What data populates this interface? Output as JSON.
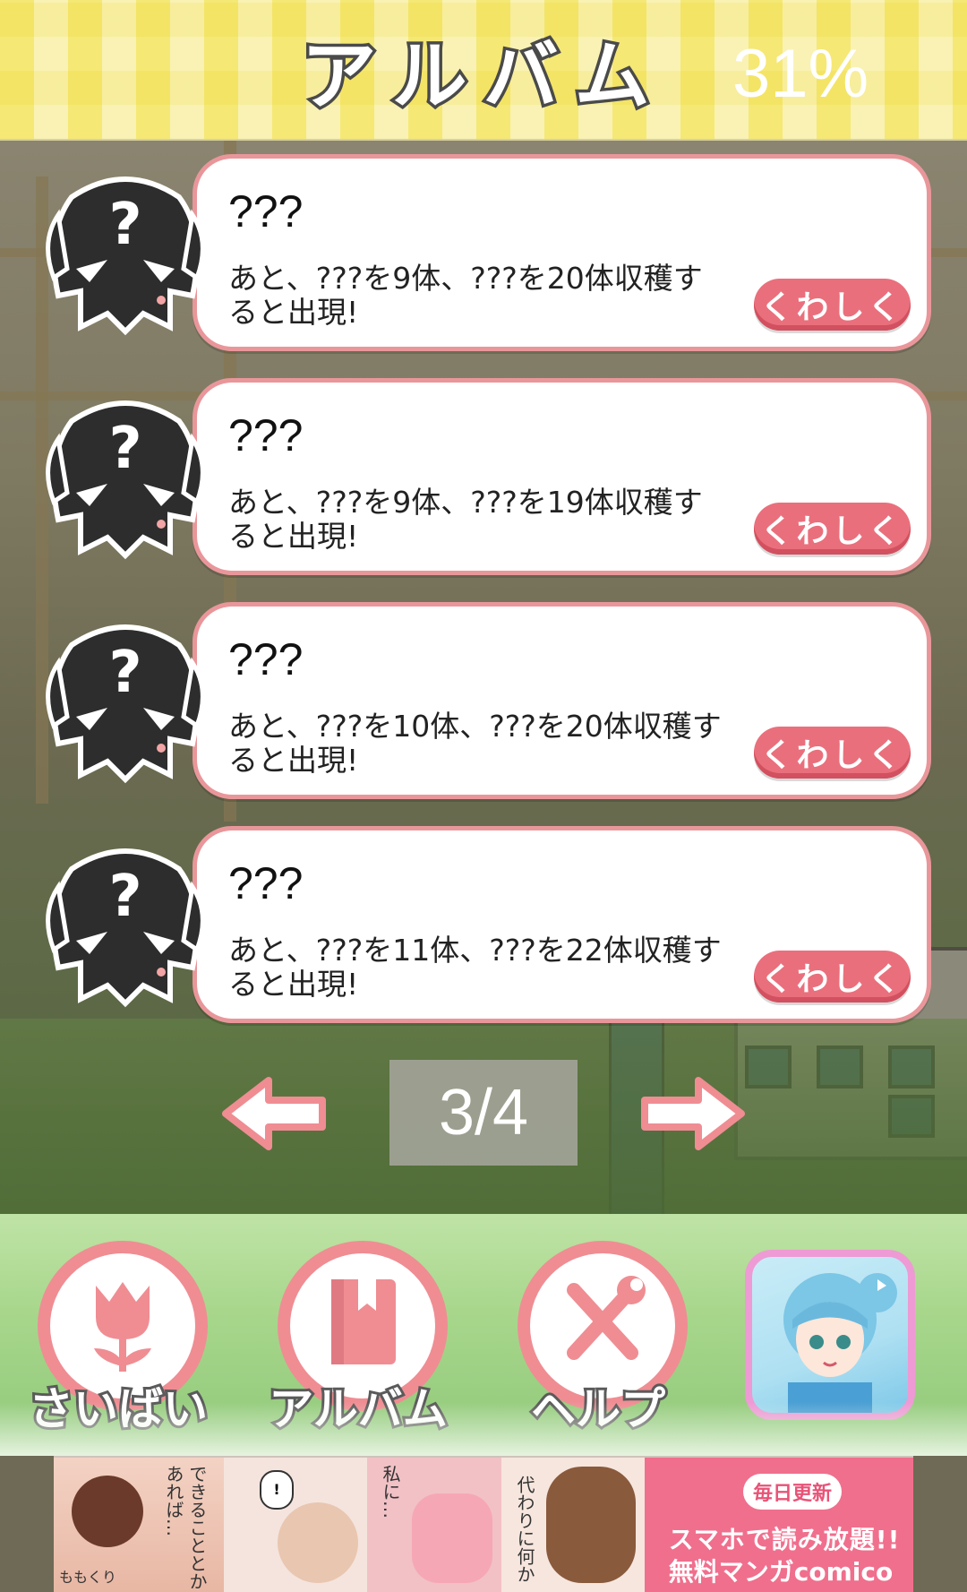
{
  "header": {
    "title": "アルバム",
    "progress_percent": "31%"
  },
  "cards": [
    {
      "name": "???",
      "description": "あと、???を9体、???を20体収穫すると出現!",
      "detail_label": "くわしく"
    },
    {
      "name": "???",
      "description": "あと、???を9体、???を19体収穫すると出現!",
      "detail_label": "くわしく"
    },
    {
      "name": "???",
      "description": "あと、???を10体、???を20体収穫すると出現!",
      "detail_label": "くわしく"
    },
    {
      "name": "???",
      "description": "あと、???を11体、???を22体収穫すると出現!",
      "detail_label": "くわしく"
    }
  ],
  "pager": {
    "indicator": "3/4",
    "prev_icon": "arrow-left-icon",
    "next_icon": "arrow-right-icon"
  },
  "nav": {
    "items": [
      {
        "label": "さいばい",
        "icon": "tulip-icon"
      },
      {
        "label": "アルバム",
        "icon": "book-icon"
      },
      {
        "label": "ヘルプ",
        "icon": "wrench-screwdriver-icon"
      }
    ],
    "promo_icon": "anime-girl-app-icon"
  },
  "ad": {
    "badge": "毎日更新",
    "line1": "スマホで読み放題!!",
    "line2": "無料マンガcomico",
    "panel_texts": [
      "あれば…",
      "できることとか",
      "私に…",
      "代わりに何か",
      "ももくり"
    ]
  },
  "colors": {
    "accent_pink": "#ea6f7c",
    "card_border": "#e9969a",
    "header_yellow": "#f7ec82"
  }
}
